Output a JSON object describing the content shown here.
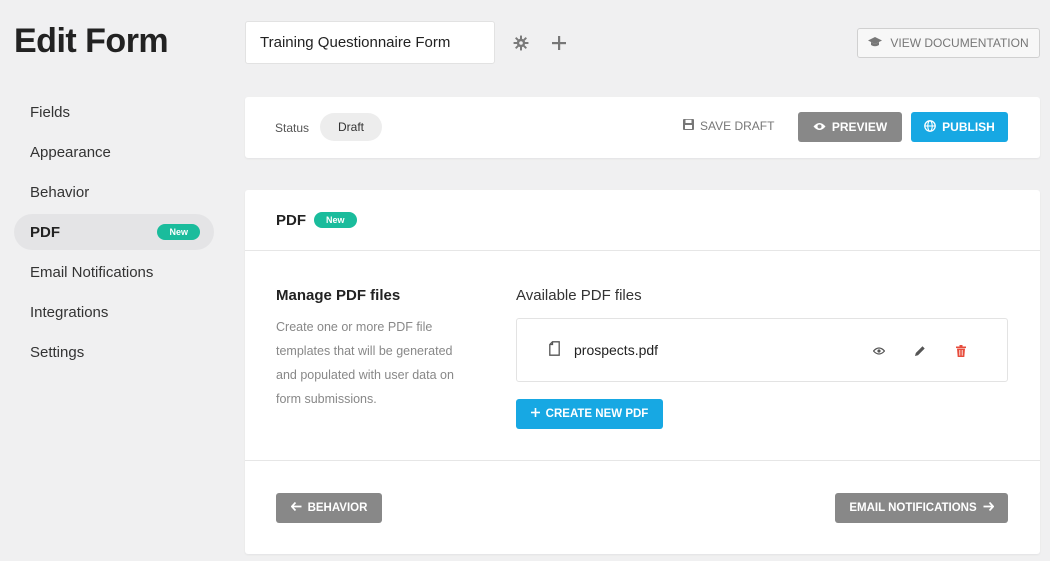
{
  "page_title": "Edit Form",
  "form_name": "Training Questionnaire Form",
  "header": {
    "doc_button": "VIEW DOCUMENTATION"
  },
  "nav": {
    "items": [
      {
        "label": "Fields"
      },
      {
        "label": "Appearance"
      },
      {
        "label": "Behavior"
      },
      {
        "label": "PDF",
        "badge": "New",
        "active": true
      },
      {
        "label": "Email Notifications"
      },
      {
        "label": "Integrations"
      },
      {
        "label": "Settings"
      }
    ]
  },
  "status": {
    "label": "Status",
    "value": "Draft",
    "save_draft": "SAVE DRAFT",
    "preview": "PREVIEW",
    "publish": "PUBLISH"
  },
  "pdf": {
    "title": "PDF",
    "badge": "New",
    "manage_title": "Manage PDF files",
    "manage_desc": "Create one or more PDF file templates that will be generated and populated with user data on form submissions.",
    "available_title": "Available PDF files",
    "files": [
      {
        "name": "prospects.pdf"
      }
    ],
    "create_button": "CREATE NEW PDF"
  },
  "footer": {
    "back_button": "BEHAVIOR",
    "next_button": "EMAIL NOTIFICATIONS"
  },
  "colors": {
    "accent": "#17a8e3",
    "badge": "#1abc9c",
    "gray_button": "#888888",
    "danger": "#e74c3c"
  }
}
